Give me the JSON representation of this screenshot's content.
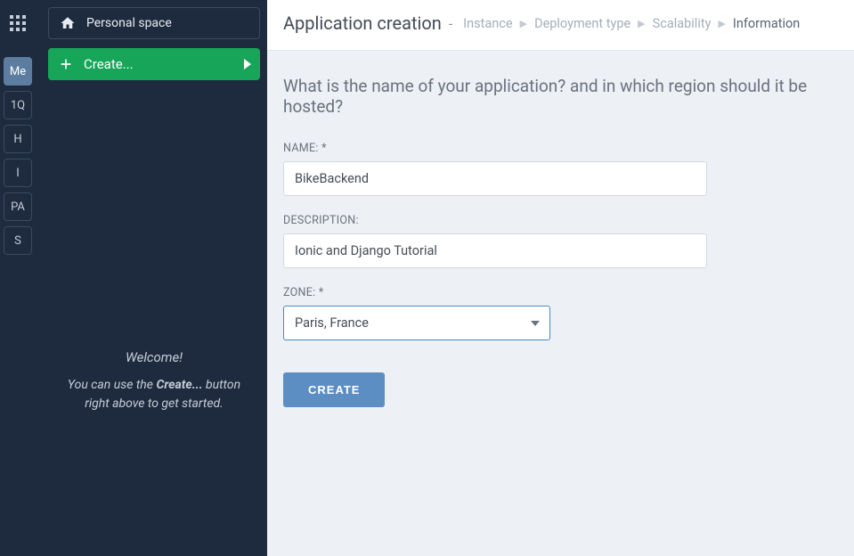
{
  "rail": {
    "items": [
      {
        "label": "Me",
        "active": true
      },
      {
        "label": "1Q",
        "active": false
      },
      {
        "label": "H",
        "active": false
      },
      {
        "label": "I",
        "active": false
      },
      {
        "label": "PA",
        "active": false
      },
      {
        "label": "S",
        "active": false
      }
    ]
  },
  "sidebar": {
    "personal_space_label": "Personal space",
    "create_label": "Create...",
    "welcome_title": "Welcome!",
    "welcome_pre": "You can use the ",
    "welcome_bold": "Create...",
    "welcome_post": " button right above to get started."
  },
  "header": {
    "title": "Application creation",
    "steps": [
      {
        "label": "Instance",
        "current": false
      },
      {
        "label": "Deployment type",
        "current": false
      },
      {
        "label": "Scalability",
        "current": false
      },
      {
        "label": "Information",
        "current": true
      }
    ]
  },
  "form": {
    "question": "What is the name of your application? and in which region should it be hosted?",
    "name_label": "NAME: *",
    "name_value": "BikeBackend",
    "description_label": "DESCRIPTION:",
    "description_value": "Ionic and Django Tutorial",
    "zone_label": "ZONE: *",
    "zone_value": "Paris, France",
    "submit_label": "CREATE"
  }
}
